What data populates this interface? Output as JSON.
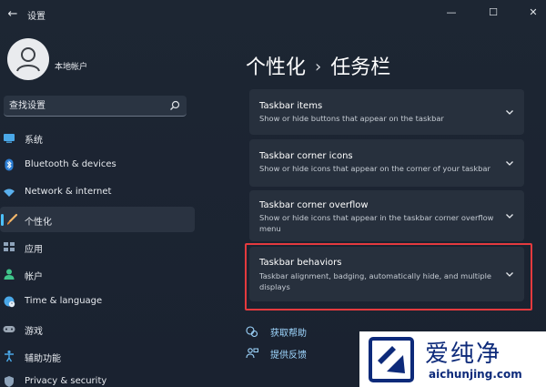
{
  "window": {
    "title": "设置",
    "back_glyph": "←",
    "minimize_glyph": "—",
    "maximize_glyph": "☐",
    "close_glyph": "✕"
  },
  "account": {
    "name": "本地帐户",
    "avatar_icon": "user-silhouette-icon"
  },
  "search": {
    "placeholder": "查找设置",
    "icon": "search-icon"
  },
  "sidebar": {
    "selected_index": 3,
    "accent_color": "#4cc2ff",
    "items": [
      {
        "label": "系统",
        "icon": "monitor-icon"
      },
      {
        "label": "Bluetooth & devices",
        "icon": "bluetooth-icon"
      },
      {
        "label": "Network & internet",
        "icon": "wifi-icon"
      },
      {
        "label": "个性化",
        "icon": "brush-icon"
      },
      {
        "label": "应用",
        "icon": "apps-icon"
      },
      {
        "label": "帐户",
        "icon": "person-icon"
      },
      {
        "label": "Time & language",
        "icon": "globe-clock-icon"
      },
      {
        "label": "游戏",
        "icon": "gamepad-icon"
      },
      {
        "label": "辅助功能",
        "icon": "accessibility-icon"
      },
      {
        "label": "Privacy & security",
        "icon": "shield-icon"
      }
    ]
  },
  "breadcrumb": {
    "parent": "个性化",
    "separator": "›",
    "current": "任务栏"
  },
  "cards": [
    {
      "title": "Taskbar items",
      "description": "Show or hide buttons that appear on the taskbar"
    },
    {
      "title": "Taskbar corner icons",
      "description": "Show or hide icons that appear on the corner of your taskbar"
    },
    {
      "title": "Taskbar corner overflow",
      "description": "Show or hide icons that appear in the taskbar corner overflow menu"
    },
    {
      "title": "Taskbar behaviors",
      "description": "Taskbar alignment, badging, automatically hide, and multiple displays",
      "highlighted": true
    }
  ],
  "highlight_color": "#e43a3e",
  "links": [
    {
      "label": "获取帮助",
      "icon": "help-icon"
    },
    {
      "label": "提供反馈",
      "icon": "feedback-icon"
    }
  ],
  "watermark": {
    "brand": "爱纯净",
    "url": "aichunjing.com",
    "color": "#0d2a7a"
  }
}
